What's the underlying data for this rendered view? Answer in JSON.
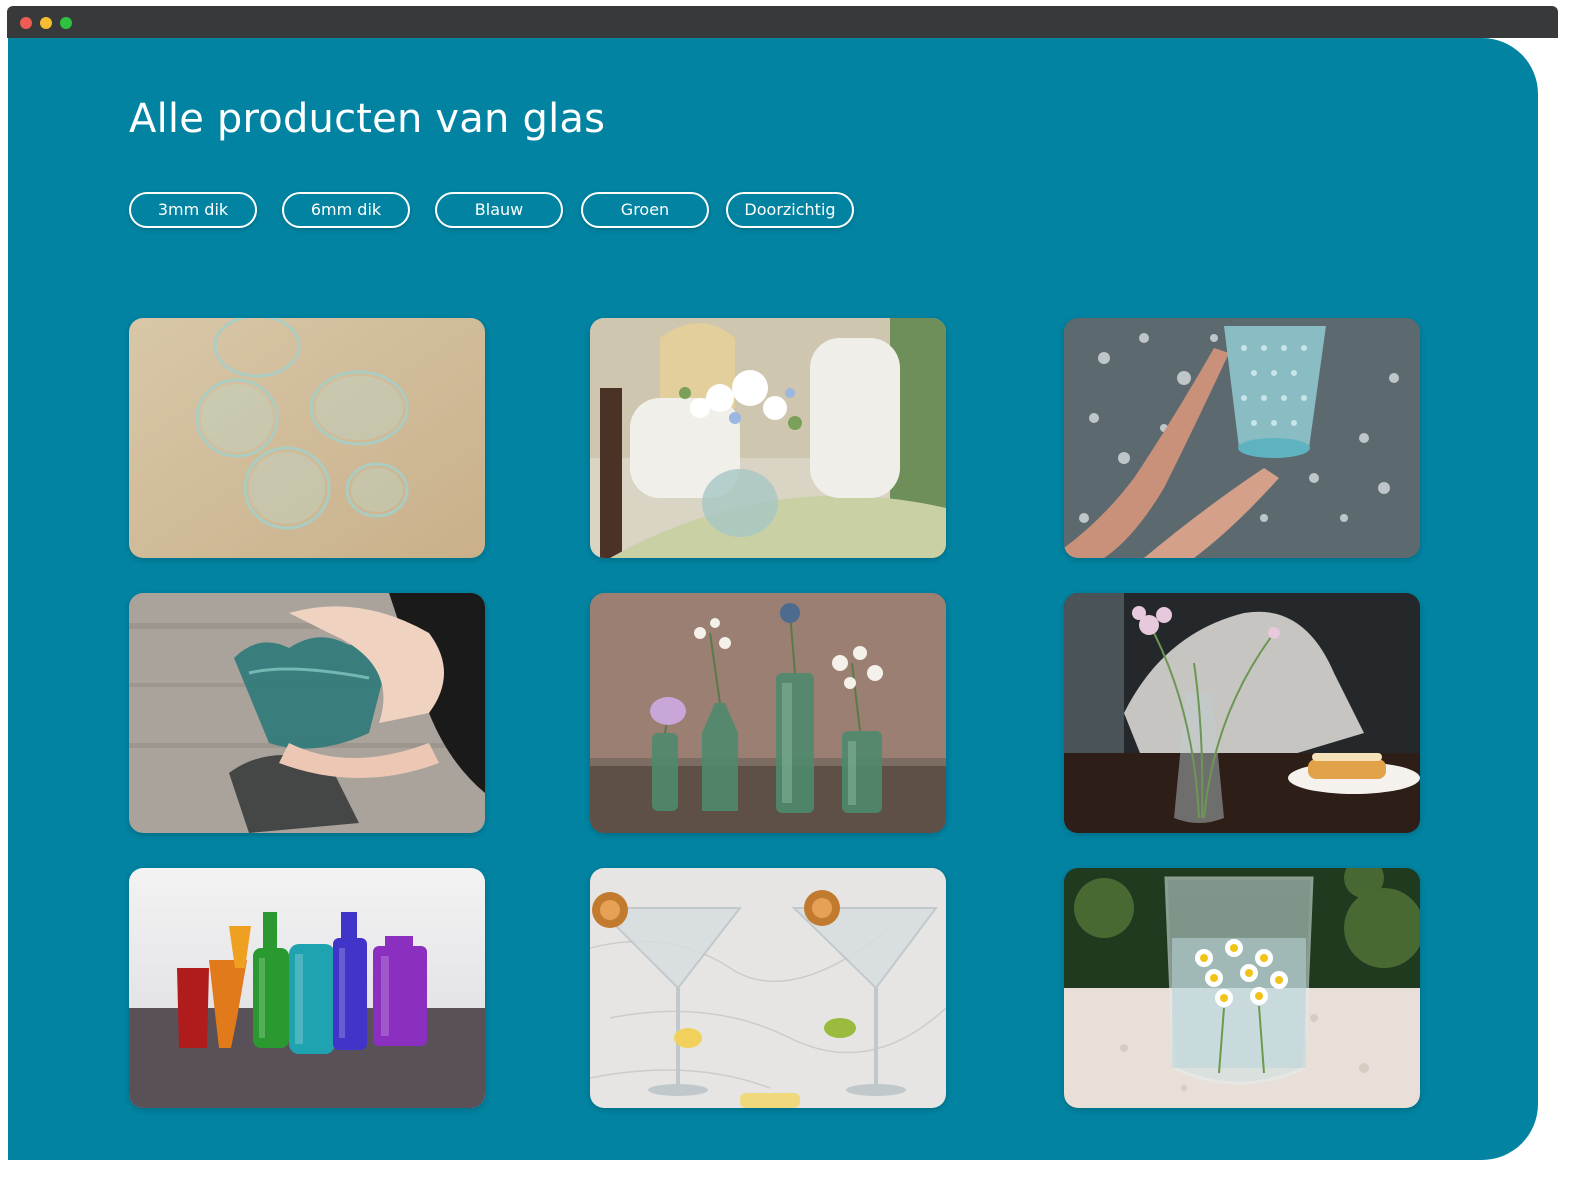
{
  "window": {
    "controls": [
      {
        "name": "close",
        "color": "#ee5c55"
      },
      {
        "name": "minimize",
        "color": "#f6bc32"
      },
      {
        "name": "maximize",
        "color": "#2fc23f"
      }
    ]
  },
  "colors": {
    "panel": "#0183a1",
    "titlebar": "#38393b",
    "text": "#ffffff"
  },
  "page": {
    "title": "Alle producten van glas"
  },
  "filters": [
    {
      "label": "3mm dik"
    },
    {
      "label": "6mm dik"
    },
    {
      "label": "Blauw"
    },
    {
      "label": "Groen"
    },
    {
      "label": "Doorzichtig"
    }
  ],
  "products": [
    {
      "image": "clear glass tumblers on beige table"
    },
    {
      "image": "girl and woman arranging flowers in glass vase"
    },
    {
      "image": "hands holding textured blue glass over sparkling water"
    },
    {
      "image": "hands holding teal wavy glass vase on stone"
    },
    {
      "image": "green glass bottles with flowers on wooden shelf"
    },
    {
      "image": "flowers in clear glass vase on dark table"
    },
    {
      "image": "colorful glass bottles and vases on table"
    },
    {
      "image": "cocktail glasses on marble with citrus slices"
    },
    {
      "image": "glass with chamomile flowers on stone ledge"
    }
  ]
}
